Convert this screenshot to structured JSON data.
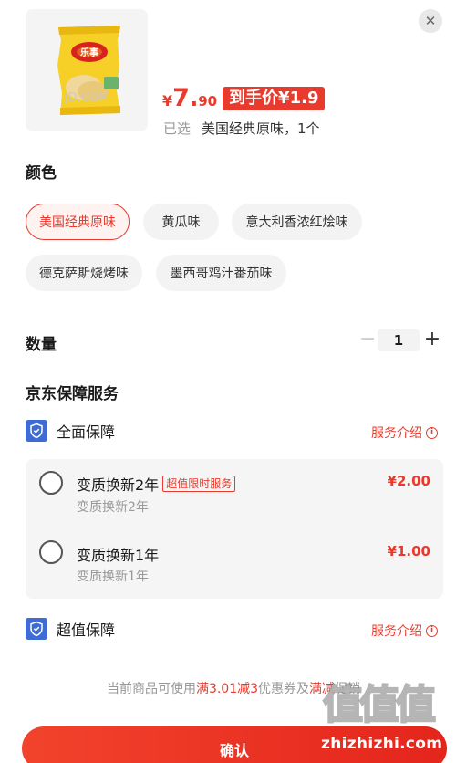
{
  "product": {
    "image_alt_icon": "potato-chip-bag-image",
    "brand_text": "乐事",
    "watermark_text": "JD.COM"
  },
  "header": {
    "price_currency": "¥",
    "price_int": "7.",
    "price_dec": "90",
    "final_price_label": "到手价¥1.9",
    "selected_label": "已选",
    "selected_value": "美国经典原味，1个",
    "close_icon": "close-icon"
  },
  "color_section": {
    "title": "颜色",
    "options": [
      {
        "label": "美国经典原味",
        "selected": true
      },
      {
        "label": "黄瓜味",
        "selected": false
      },
      {
        "label": "意大利香浓红烩味",
        "selected": false
      },
      {
        "label": "德克萨斯烧烤味",
        "selected": false
      },
      {
        "label": "墨西哥鸡汁番茄味",
        "selected": false
      }
    ]
  },
  "quantity_section": {
    "title": "数量",
    "minus": "−",
    "value": "1",
    "plus": "+"
  },
  "service_section": {
    "title": "京东保障服务",
    "groups": [
      {
        "label": "全面保障",
        "intro": "服务介绍",
        "options": [
          {
            "name": "变质换新2年",
            "tag": "超值限时服务",
            "sub": "变质换新2年",
            "price": "¥2.00"
          },
          {
            "name": "变质换新1年",
            "tag": "",
            "sub": "变质换新1年",
            "price": "¥1.00"
          }
        ]
      },
      {
        "label": "超值保障",
        "intro": "服务介绍"
      }
    ]
  },
  "coupon_note": {
    "prefix": "当前商品可使用",
    "hl1": "满3.01减3",
    "mid": "优惠券及",
    "hl2": "满减",
    "suffix": "促销"
  },
  "confirm_label": "确认",
  "site_watermark": {
    "glyphs": "值值值",
    "url": "zhizhizhi.com"
  },
  "colors": {
    "accent": "#e93b2d",
    "chip_bg": "#f3f3f3",
    "shield": "#3f6bd6"
  }
}
